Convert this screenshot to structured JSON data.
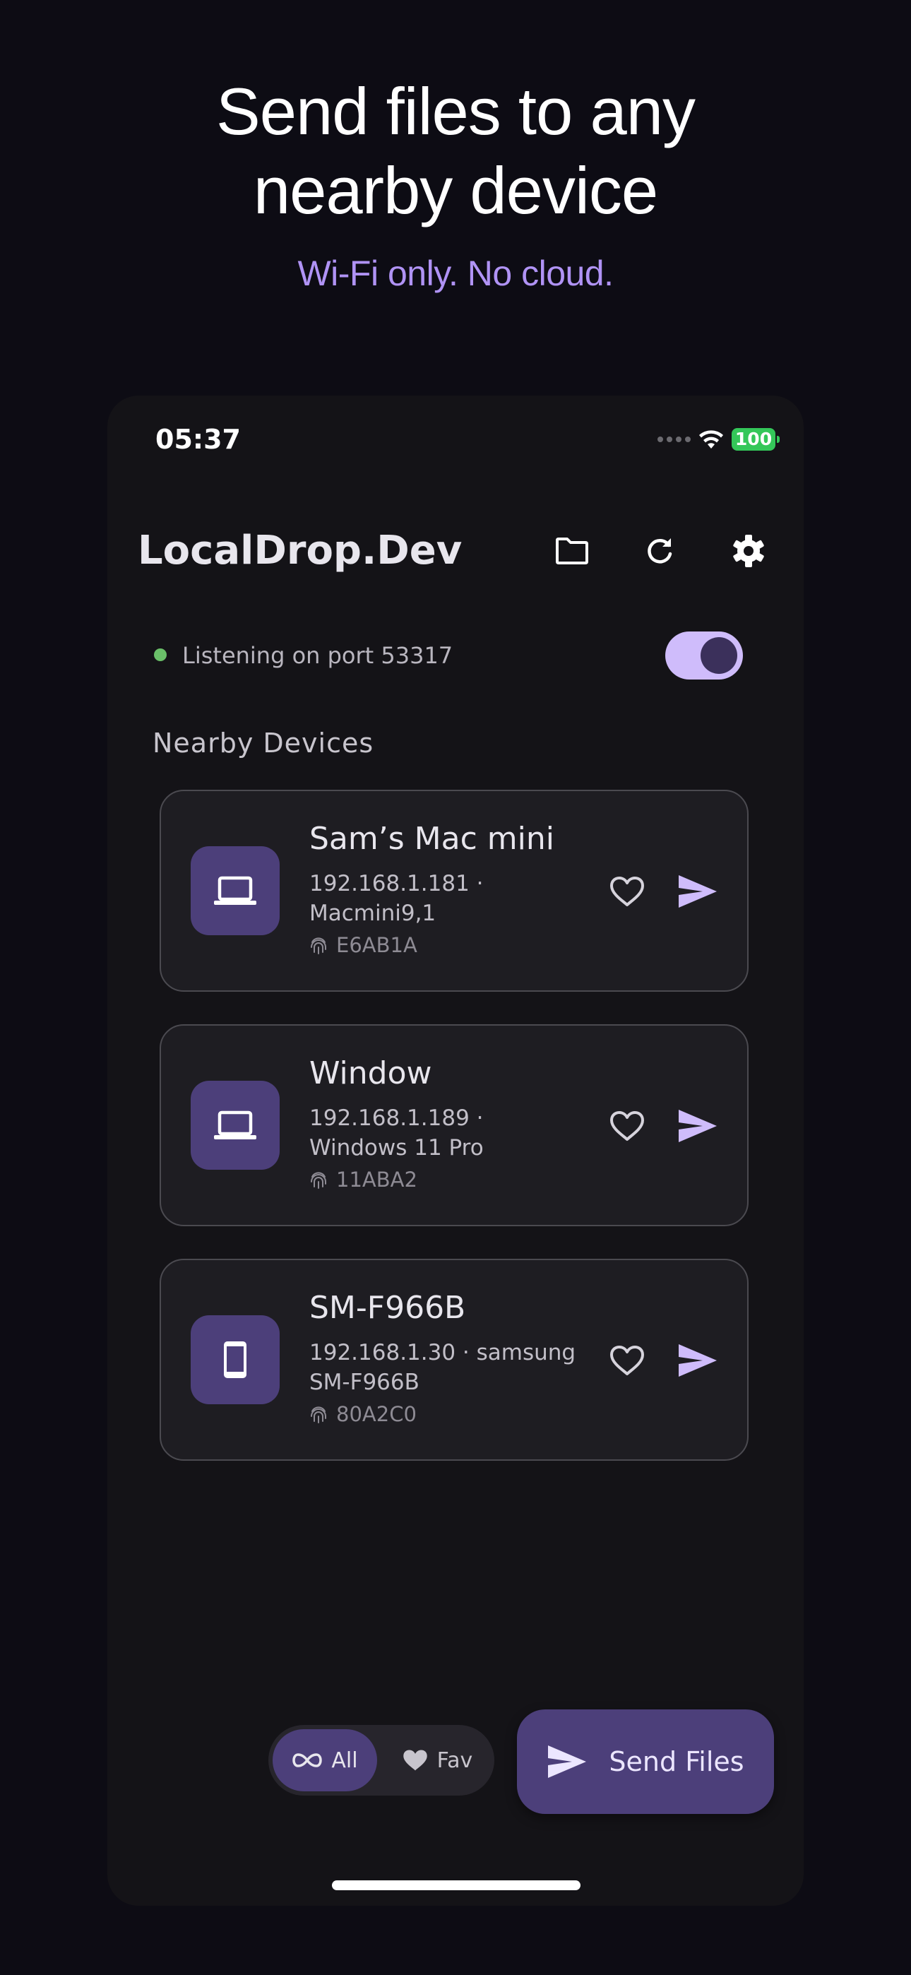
{
  "promo": {
    "title_line1": "Send files to any",
    "title_line2": "nearby device",
    "subtitle": "Wi-Fi only. No cloud."
  },
  "status_bar": {
    "time": "05:37",
    "battery": "100"
  },
  "header": {
    "title": "LocalDrop.Dev",
    "icons": [
      "folder-icon",
      "refresh-icon",
      "settings-gear-icon"
    ]
  },
  "server": {
    "status_text": "Listening on port 53317",
    "enabled": true
  },
  "section_title": "Nearby Devices",
  "devices": [
    {
      "name": "Sam’s Mac mini",
      "meta_line1": "192.168.1.181 ·",
      "meta_line2": "Macmini9,1",
      "fingerprint": "E6AB1A",
      "icon": "laptop-icon"
    },
    {
      "name": "Window",
      "meta_line1": "192.168.1.189 ·",
      "meta_line2": "Windows 11 Pro",
      "fingerprint": "11ABA2",
      "icon": "laptop-icon"
    },
    {
      "name": "SM-F966B",
      "meta_line1": "192.168.1.30 · samsung",
      "meta_line2": "SM-F966B",
      "fingerprint": "80A2C0",
      "icon": "phone-icon"
    }
  ],
  "filter": {
    "all_label": "All",
    "fav_label": "Fav",
    "selected": "All"
  },
  "send_files_label": "Send Files",
  "colors": {
    "background": "#0d0c14",
    "surface": "#141317",
    "card": "#1e1d22",
    "accent": "#cfbcfb",
    "accent_container": "#4c3f7a",
    "subtitle": "#b093f5",
    "status_green": "#6abf69"
  }
}
